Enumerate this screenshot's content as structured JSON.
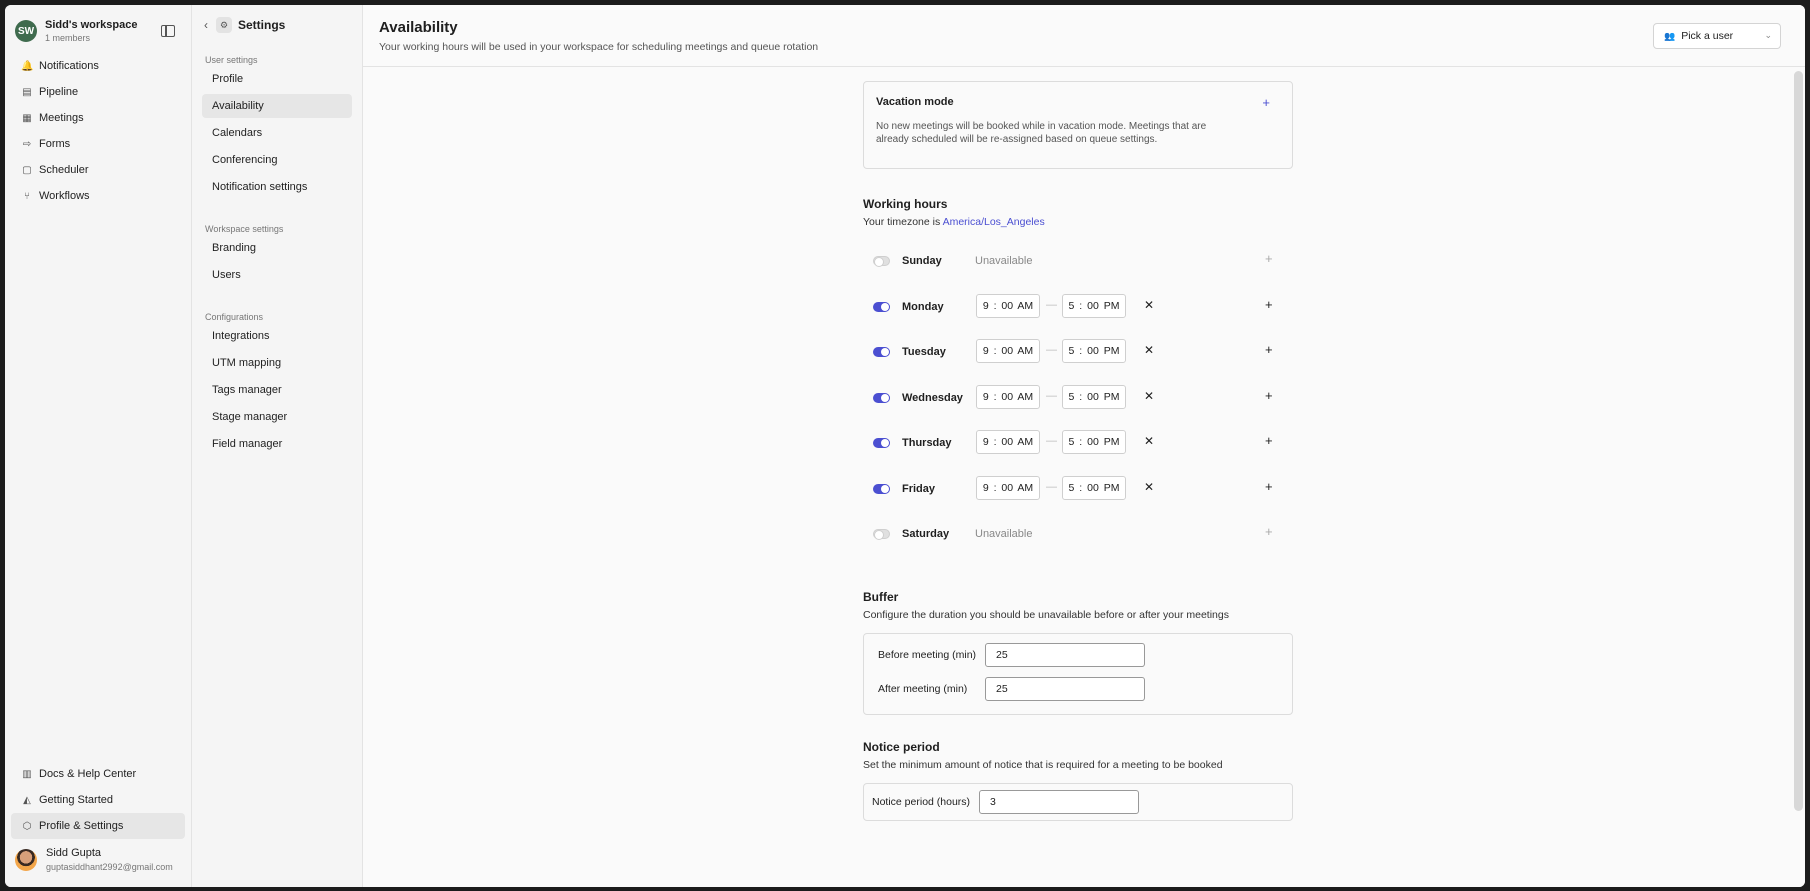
{
  "workspace": {
    "avatar": "SW",
    "name": "Sidd's workspace",
    "members": "1 members"
  },
  "nav": [
    {
      "label": "Notifications",
      "icon": "bell-icon",
      "glyph": "🔔"
    },
    {
      "label": "Pipeline",
      "icon": "pipeline-icon",
      "glyph": "▤"
    },
    {
      "label": "Meetings",
      "icon": "meetings-icon",
      "glyph": "▦"
    },
    {
      "label": "Forms",
      "icon": "forms-icon",
      "glyph": "⇨"
    },
    {
      "label": "Scheduler",
      "icon": "calendar-icon",
      "glyph": "▢"
    },
    {
      "label": "Workflows",
      "icon": "workflow-icon",
      "glyph": "⑂"
    }
  ],
  "bottom_nav": [
    {
      "label": "Docs & Help Center",
      "icon": "book-icon",
      "glyph": "▥"
    },
    {
      "label": "Getting Started",
      "icon": "graduation-icon",
      "glyph": "◭"
    },
    {
      "label": "Profile & Settings",
      "icon": "settings-hex-icon",
      "glyph": "⬡"
    }
  ],
  "user": {
    "name": "Sidd Gupta",
    "email": "guptasiddhant2992@gmail.com"
  },
  "settings": {
    "title": "Settings",
    "user_settings_label": "User settings",
    "user_settings": [
      "Profile",
      "Availability",
      "Calendars",
      "Conferencing",
      "Notification settings"
    ],
    "workspace_settings_label": "Workspace settings",
    "workspace_settings": [
      "Branding",
      "Users"
    ],
    "configurations_label": "Configurations",
    "configurations": [
      "Integrations",
      "UTM mapping",
      "Tags manager",
      "Stage manager",
      "Field manager"
    ]
  },
  "header": {
    "title": "Availability",
    "subtitle": "Your working hours will be used in your workspace for scheduling meetings and queue rotation",
    "pick_user": "Pick a user"
  },
  "vacation": {
    "title": "Vacation mode",
    "description": "No new meetings will be booked while in vacation mode. Meetings that are already scheduled will be re-assigned based on queue settings."
  },
  "working_hours": {
    "title": "Working hours",
    "timezone_prefix": "Your timezone is ",
    "timezone": "America/Los_Angeles",
    "unavailable_label": "Unavailable",
    "dash": "—",
    "remove": "✕",
    "add": "+",
    "days": [
      {
        "name": "Sunday",
        "enabled": false
      },
      {
        "name": "Monday",
        "enabled": true,
        "start": "9 : 00  AM",
        "end": "5 : 00  PM"
      },
      {
        "name": "Tuesday",
        "enabled": true,
        "start": "9 : 00  AM",
        "end": "5 : 00  PM"
      },
      {
        "name": "Wednesday",
        "enabled": true,
        "start": "9 : 00  AM",
        "end": "5 : 00  PM"
      },
      {
        "name": "Thursday",
        "enabled": true,
        "start": "9 : 00  AM",
        "end": "5 : 00  PM"
      },
      {
        "name": "Friday",
        "enabled": true,
        "start": "9 : 00  AM",
        "end": "5 : 00  PM"
      },
      {
        "name": "Saturday",
        "enabled": false
      }
    ]
  },
  "buffer": {
    "title": "Buffer",
    "subtitle": "Configure the duration you should be unavailable before or after your meetings",
    "before_label": "Before meeting (min)",
    "before_value": "25",
    "after_label": "After meeting (min)",
    "after_value": "25"
  },
  "notice": {
    "title": "Notice period",
    "subtitle": "Set the minimum amount of notice that is required for a meeting to be booked",
    "label": "Notice period (hours)",
    "value": "3"
  },
  "colors": {
    "accent": "#4b4fd1",
    "workspace_avatar": "#3f6b4e"
  }
}
